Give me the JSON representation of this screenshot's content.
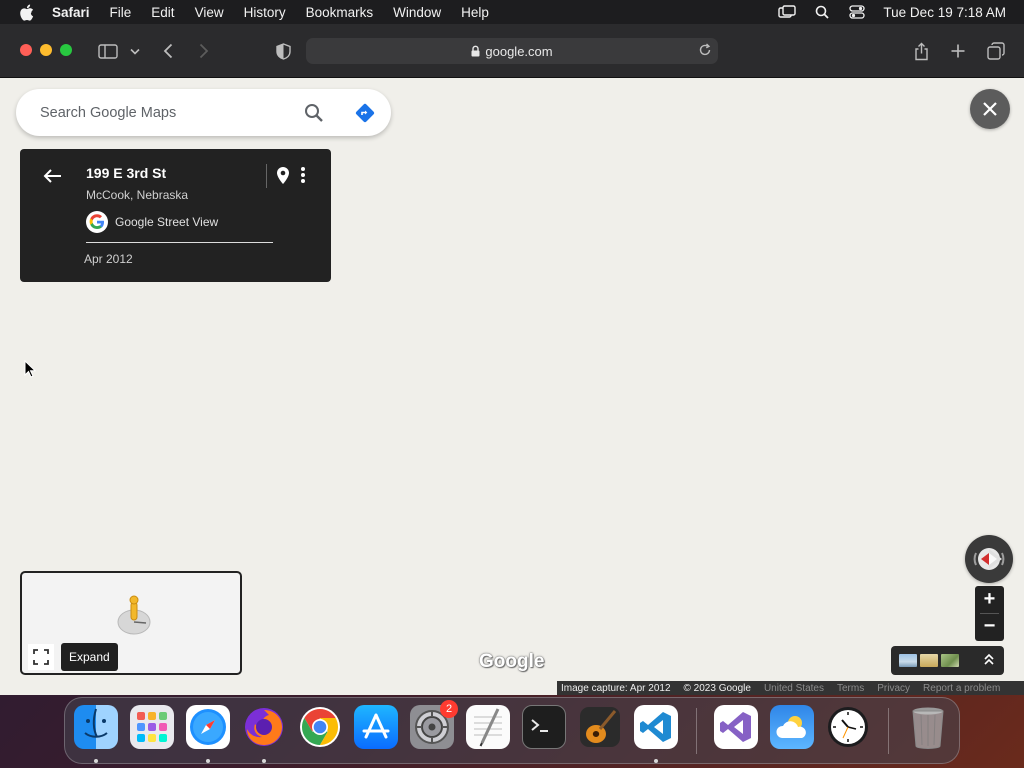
{
  "menubar": {
    "app_name": "Safari",
    "items": [
      "File",
      "Edit",
      "View",
      "History",
      "Bookmarks",
      "Window",
      "Help"
    ],
    "clock": "Tue Dec 19  7:18 AM"
  },
  "browser": {
    "url": "google.com"
  },
  "search": {
    "placeholder": "Search Google Maps"
  },
  "info_card": {
    "title": "199 E 3rd St",
    "subtitle": "McCook, Nebraska",
    "source": "Google Street View",
    "date": "Apr 2012"
  },
  "minimap": {
    "expand_label": "Expand"
  },
  "map": {
    "wordmark": "Google",
    "zoom_in": "+",
    "zoom_out": "−"
  },
  "attribution": {
    "capture": "Image capture: Apr 2012",
    "copyright": "© 2023 Google",
    "country": "United States",
    "terms": "Terms",
    "privacy": "Privacy",
    "report": "Report a problem"
  },
  "dock": {
    "items": [
      {
        "name": "Finder",
        "icon": "finder-icon"
      },
      {
        "name": "Launchpad",
        "icon": "launchpad-icon"
      },
      {
        "name": "Safari",
        "icon": "safari-icon"
      },
      {
        "name": "Firefox",
        "icon": "firefox-icon"
      },
      {
        "name": "Chrome",
        "icon": "chrome-icon"
      },
      {
        "name": "App Store",
        "icon": "app-store-icon"
      },
      {
        "name": "System Preferences",
        "icon": "system-preferences-icon",
        "badge": "2"
      },
      {
        "name": "TextEdit",
        "icon": "textedit-icon"
      },
      {
        "name": "Terminal",
        "icon": "terminal-icon"
      },
      {
        "name": "GarageBand",
        "icon": "garageband-icon"
      },
      {
        "name": "Visual Studio Code",
        "icon": "vscode-icon"
      },
      {
        "name": "Visual Studio",
        "icon": "visual-studio-icon"
      },
      {
        "name": "Weather",
        "icon": "weather-icon"
      },
      {
        "name": "Clock",
        "icon": "clock-icon"
      },
      {
        "name": "Trash",
        "icon": "trash-icon"
      }
    ]
  },
  "colors": {
    "menubar_bg": "#1d1d1f",
    "toolbar_bg": "#2b2b2d",
    "map_bg": "#f0efea",
    "card_bg": "#222222",
    "directions_blue": "#1a73e8"
  }
}
